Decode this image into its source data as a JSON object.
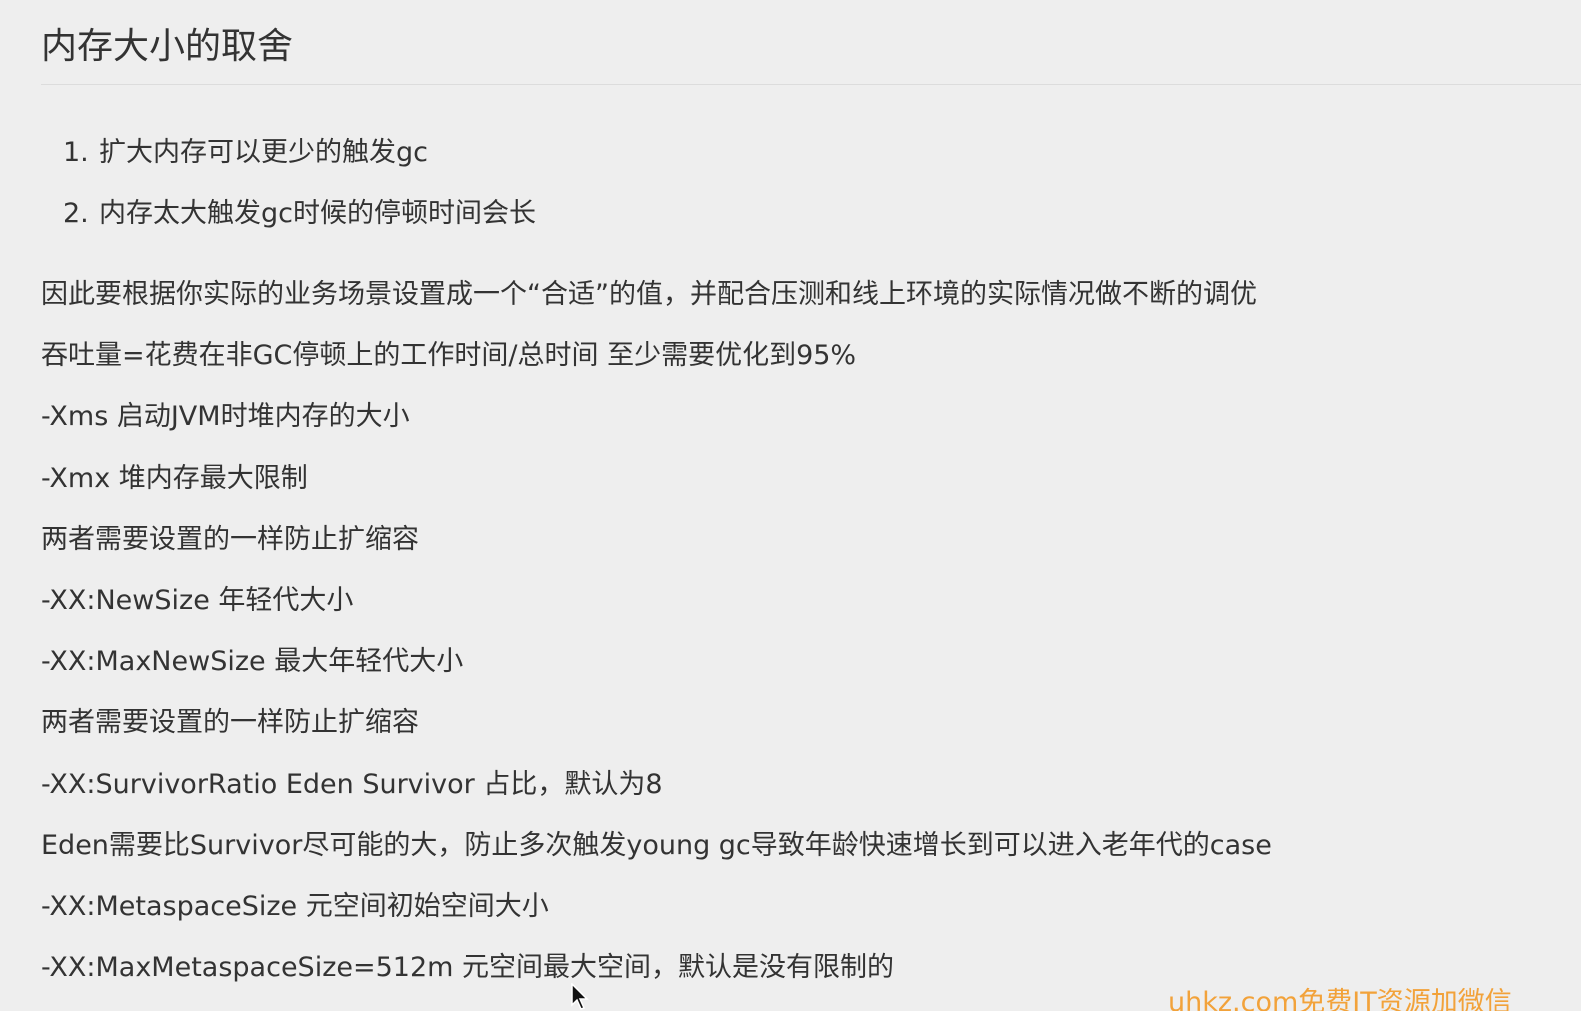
{
  "title": "内存大小的取舍",
  "list": [
    {
      "num": "1.",
      "text": "扩大内存可以更少的触发gc"
    },
    {
      "num": "2.",
      "text": "内存太大触发gc时候的停顿时间会长"
    }
  ],
  "paragraphs": [
    "因此要根据你实际的业务场景设置成一个“合适”的值，并配合压测和线上环境的实际情况做不断的调优",
    "吞吐量=花费在非GC停顿上的工作时间/总时间 至少需要优化到95%",
    "-Xms 启动JVM时堆内存的大小",
    "-Xmx 堆内存最大限制",
    "两者需要设置的一样防止扩缩容",
    "-XX:NewSize 年轻代大小",
    "-XX:MaxNewSize 最大年轻代大小",
    "两者需要设置的一样防止扩缩容",
    "-XX:SurvivorRatio Eden Survivor 占比，默认为8",
    "Eden需要比Survivor尽可能的大，防止多次触发young gc导致年龄快速增长到可以进入老年代的case",
    "-XX:MetaspaceSize 元空间初始空间大小",
    "-XX:MaxMetaspaceSize=512m 元空间最大空间，默认是没有限制的"
  ],
  "watermark": "uhkz.com免费IT资源加微信",
  "colors": {
    "background": "#eeeeee",
    "text": "#333333",
    "watermark": "#f2a23a"
  },
  "icons": {
    "cursor": "mouse-pointer-icon"
  }
}
